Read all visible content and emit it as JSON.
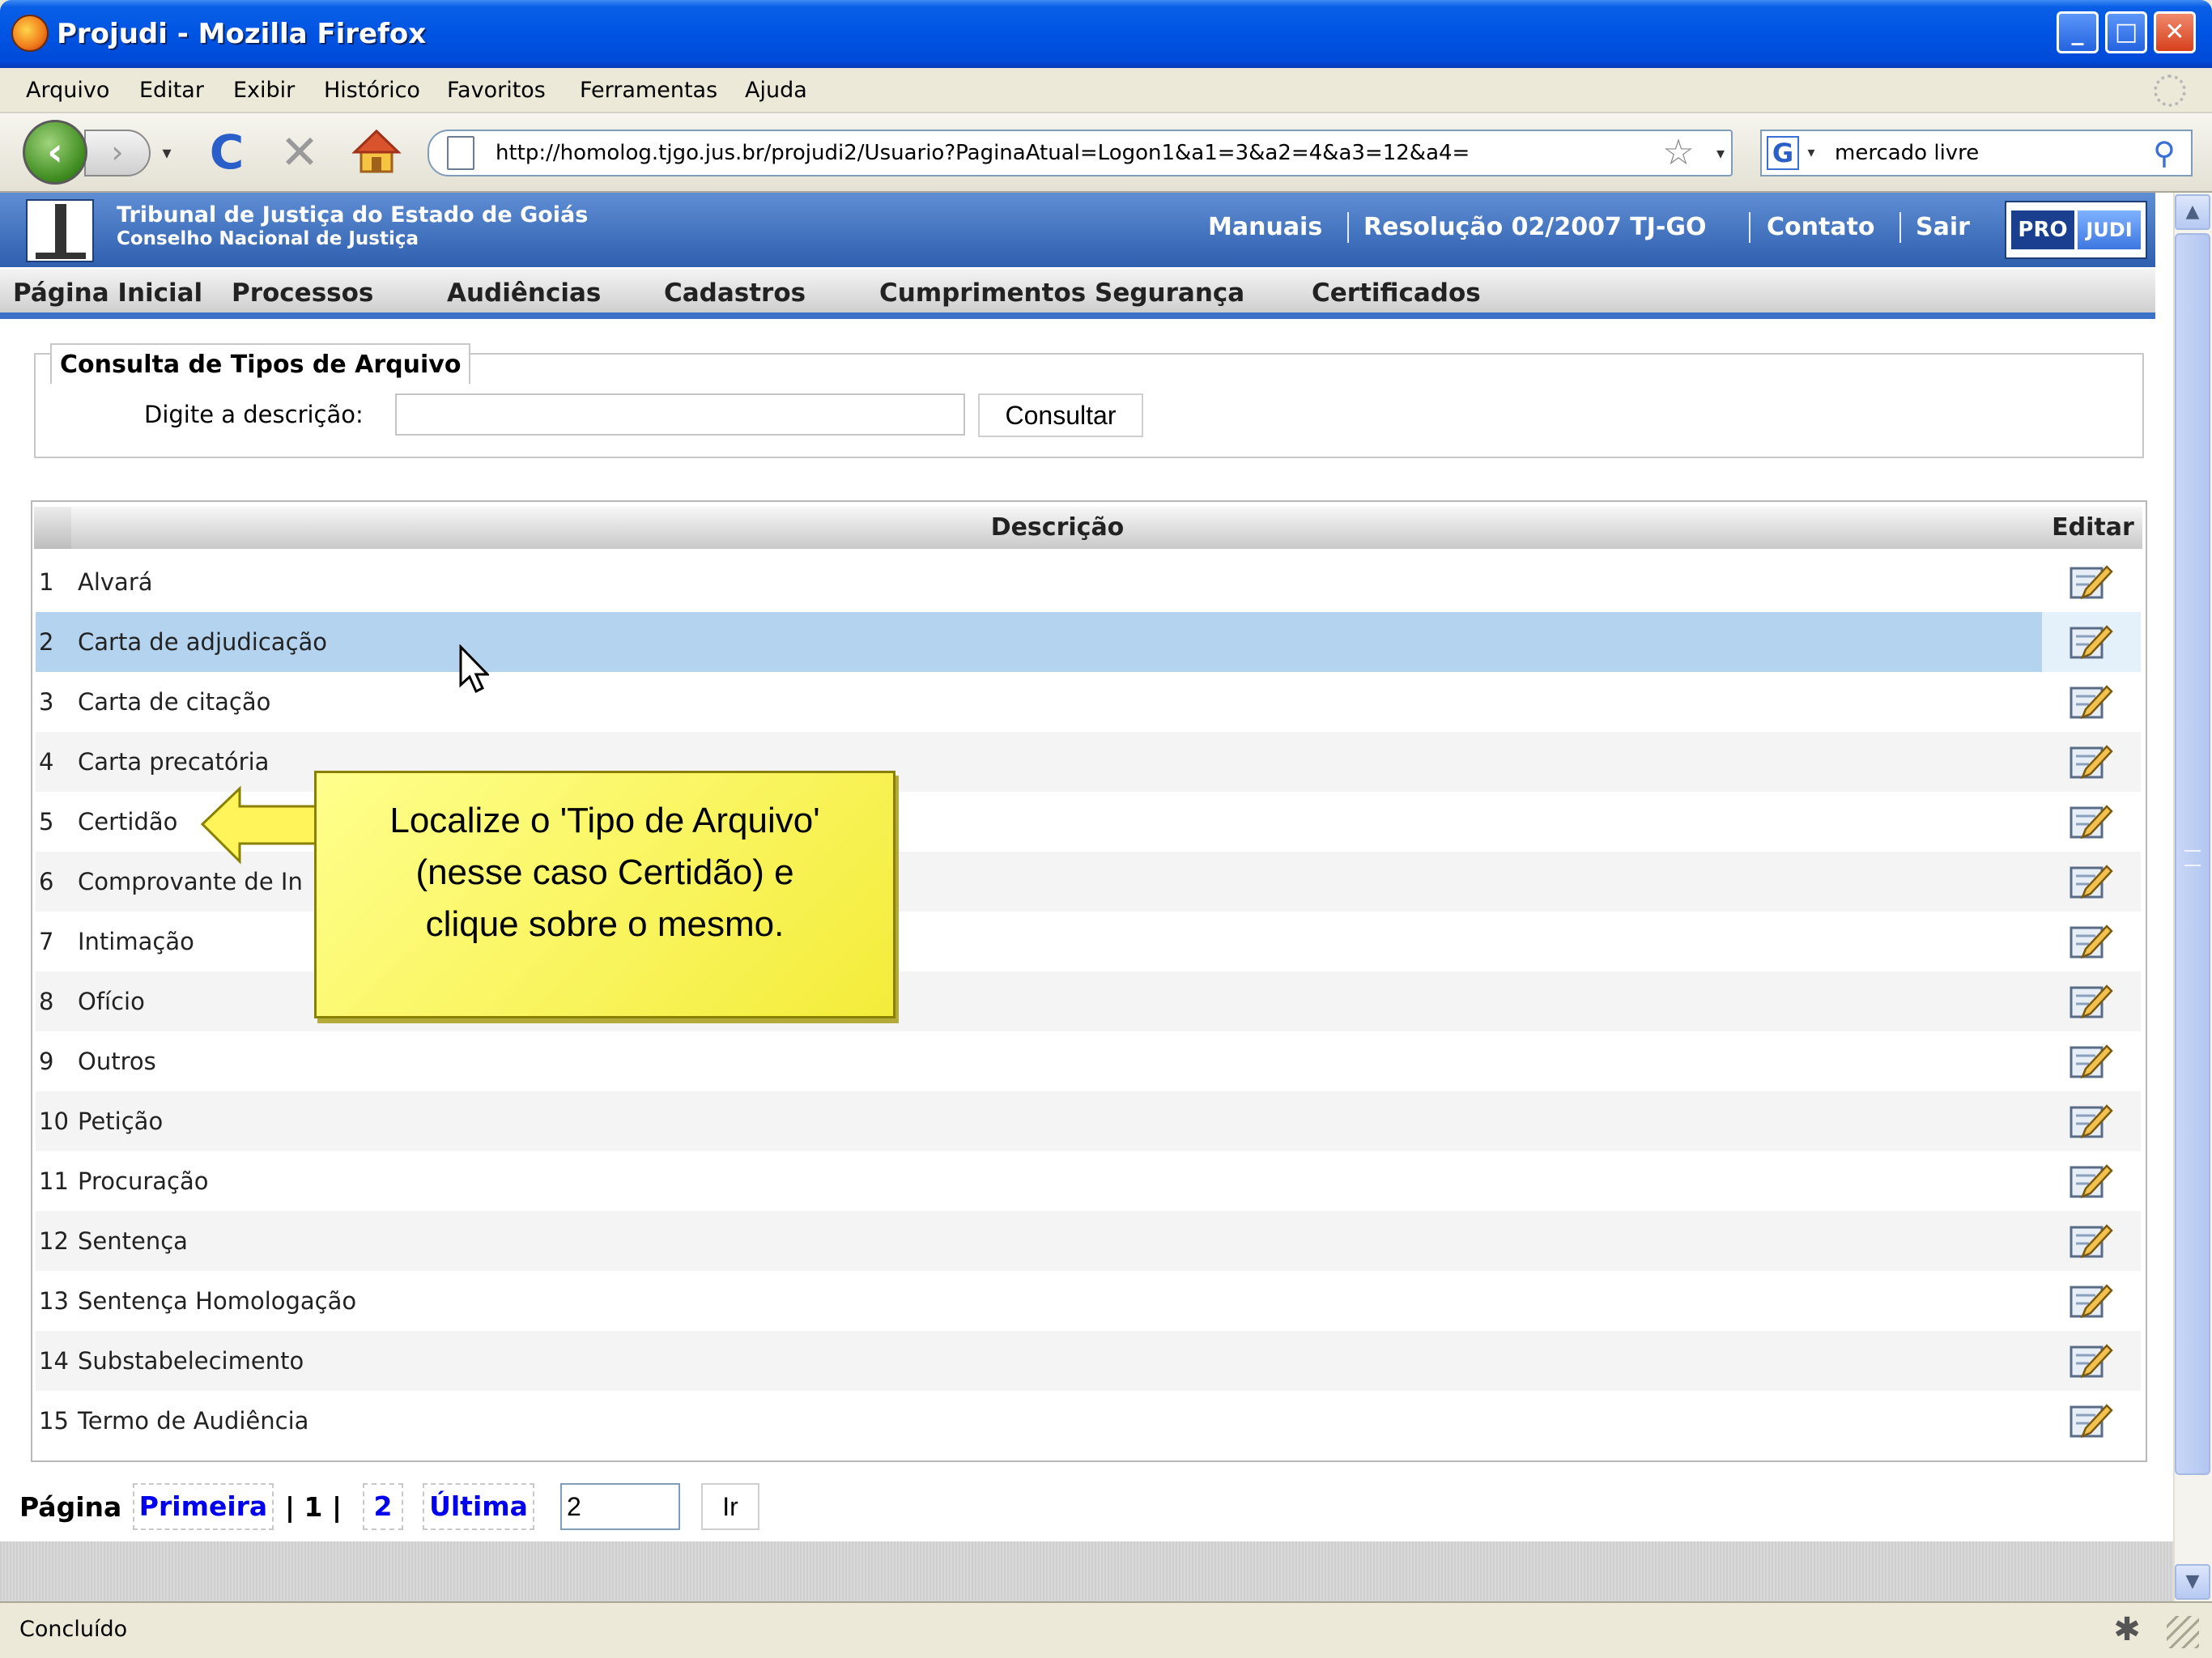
{
  "window": {
    "title": "Projudi - Mozilla Firefox",
    "min": "_",
    "max": "□",
    "close": "✕"
  },
  "menu": [
    "Arquivo",
    "Editar",
    "Exibir",
    "Histórico",
    "Favoritos",
    "Ferramentas",
    "Ajuda"
  ],
  "toolbar": {
    "back": "‹",
    "forward": "›",
    "dropdown": "▾",
    "reload": "C",
    "stop": "✕",
    "url": "http://homolog.tjgo.jus.br/projudi2/Usuario?PaginaAtual=Logon1&a1=3&a2=4&a3=12&a4=",
    "bookmark_star": "☆",
    "search_engine": "G",
    "search_value": "mercado livre",
    "search_go": "⚲"
  },
  "site": {
    "court_name": "Tribunal de Justiça do Estado de Goiás",
    "court_sub": "Conselho Nacional de Justiça",
    "links": [
      "Manuais",
      "Resolução 02/2007 TJ-GO",
      "Contato",
      "Sair"
    ],
    "logo_pro": "PRO",
    "logo_judi": "JUDI",
    "nav": [
      "Página Inicial",
      "Processos",
      "Audiências",
      "Cadastros",
      "Cumprimentos",
      "Segurança",
      "Certificados"
    ]
  },
  "query": {
    "legend": "Consulta de Tipos de Arquivo",
    "label": "Digite a descrição:",
    "input_value": "",
    "button": "Consultar"
  },
  "table": {
    "header_desc": "Descrição",
    "header_edit": "Editar",
    "rows": [
      {
        "num": "1",
        "desc": "Alvará"
      },
      {
        "num": "2",
        "desc": "Carta de adjudicação"
      },
      {
        "num": "3",
        "desc": "Carta de citação"
      },
      {
        "num": "4",
        "desc": "Carta precatória"
      },
      {
        "num": "5",
        "desc": "Certidão"
      },
      {
        "num": "6",
        "desc": "Comprovante de In"
      },
      {
        "num": "7",
        "desc": "Intimação"
      },
      {
        "num": "8",
        "desc": "Ofício"
      },
      {
        "num": "9",
        "desc": "Outros"
      },
      {
        "num": "10",
        "desc": "Petição"
      },
      {
        "num": "11",
        "desc": "Procuração"
      },
      {
        "num": "12",
        "desc": "Sentença"
      },
      {
        "num": "13",
        "desc": "Sentença Homologação"
      },
      {
        "num": "14",
        "desc": "Substabelecimento"
      },
      {
        "num": "15",
        "desc": "Termo de Audiência"
      }
    ]
  },
  "pager": {
    "label": "Página",
    "first": "Primeira",
    "current": "| 1 |",
    "next_page": "2",
    "last": "Última",
    "input_value": "2",
    "go": "Ir"
  },
  "callout": {
    "line1": "Localize o 'Tipo de Arquivo'",
    "line2": "(nesse caso Certidão) e",
    "line3": "clique sobre o mesmo."
  },
  "status": "Concluído",
  "colors": {
    "titlebar": "#0054e3",
    "header_blue": "#3b71c7",
    "highlight_row": "#b3d3ef",
    "callout_yellow": "#ffff8c",
    "link_blue": "#0000ee"
  }
}
